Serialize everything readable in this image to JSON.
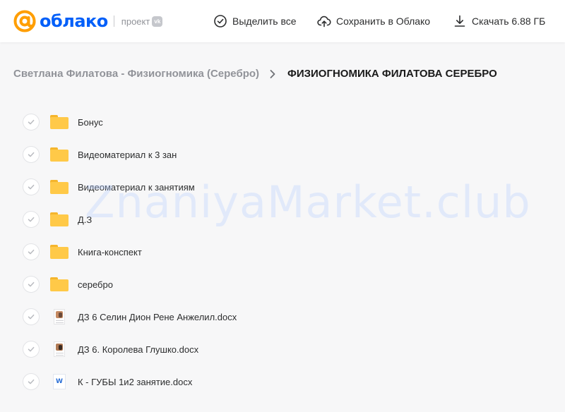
{
  "brand": {
    "logo_text": "облако",
    "sub_label": "проект",
    "vk_label": "vk",
    "accent_color": "#005ff9",
    "logo_orange": "#ff9e00"
  },
  "actions": {
    "select_all": "Выделить все",
    "save_to_cloud": "Сохранить в Облако",
    "download": "Скачать 6.88 ГБ"
  },
  "breadcrumb": {
    "parent": "Светлана Филатова - Физиогномика (Серебро)",
    "current": "ФИЗИОГНОМИКА ФИЛАТОВА СЕРЕБРО"
  },
  "files": [
    {
      "name": "Бонус",
      "icon": "folder-icon"
    },
    {
      "name": "Видеоматериал к 3 зан",
      "icon": "folder-icon"
    },
    {
      "name": "Видеоматериал к занятиям",
      "icon": "folder-icon"
    },
    {
      "name": "Д.З",
      "icon": "folder-icon"
    },
    {
      "name": "Книга-конспект",
      "icon": "folder-icon"
    },
    {
      "name": "серебро",
      "icon": "folder-icon"
    },
    {
      "name": "ДЗ 6 Селин Дион Рене Анжелил.docx",
      "icon": "docx-thumbnail-icon"
    },
    {
      "name": "ДЗ 6. Королева Глушко.docx",
      "icon": "docx-thumbnail-icon"
    },
    {
      "name": "К - ГУБЫ 1и2 занятие.docx",
      "icon": "word-doc-icon"
    }
  ],
  "watermark": "ZnaniyaMarket.club"
}
